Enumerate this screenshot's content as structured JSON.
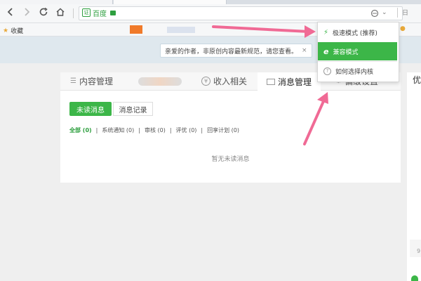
{
  "browser": {
    "site_name": "百度",
    "bookmark_label": "收藏",
    "top_right_label": "日"
  },
  "notice": {
    "text": "亲爱的作者，非原创内容最新规范，请您查看。",
    "close": "×"
  },
  "tabs": [
    {
      "label": "内容管理",
      "icon": "list-icon"
    },
    {
      "label": "",
      "icon": "blurred-tab"
    },
    {
      "label": "收入相关",
      "icon": "yen-icon"
    },
    {
      "label": "消息管理",
      "icon": "mail-icon"
    },
    {
      "label": "偏级设置",
      "icon": "settings-icon"
    }
  ],
  "tabs_more": "»",
  "messages": {
    "unread_button": "未读消息",
    "records_button": "消息记录",
    "filters": [
      {
        "label": "全部 (0)",
        "active": true
      },
      {
        "label": "系统通知 (0)",
        "active": false
      },
      {
        "label": "审核 (0)",
        "active": false
      },
      {
        "label": "评优 (0)",
        "active": false
      },
      {
        "label": "回享计划 (0)",
        "active": false
      }
    ],
    "separator": "|",
    "empty_text": "暂无未读消息"
  },
  "dropdown": {
    "items": [
      {
        "label": "极速模式 (推荐)",
        "icon": "lightning-icon"
      },
      {
        "label": "兼容模式",
        "icon": "ie-icon"
      },
      {
        "label": "如何选择内核",
        "icon": "help-icon"
      }
    ]
  },
  "side": {
    "title_char": "优",
    "bottom_text": "9."
  },
  "colors": {
    "accent": "#3cb648",
    "arrow": "#f06a95"
  }
}
